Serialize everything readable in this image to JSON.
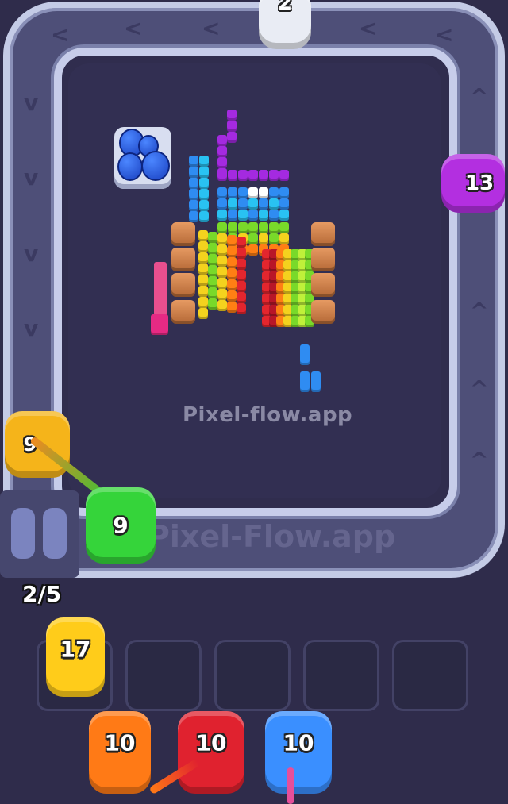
{
  "game": {
    "watermark": "Pixel-flow.app",
    "belt_watermark": "Pixel-Flow.app",
    "queue_counter": "2/5",
    "chevron_left": "<",
    "chevron_up": "^",
    "chevron_down": "v"
  },
  "belt_pigs": {
    "top": {
      "count": "2",
      "color": "#e9ecf4"
    },
    "right": {
      "count": "13",
      "color": "#b32fe0"
    },
    "left": {
      "count": "9",
      "color": "#f5b41a"
    },
    "bottom": {
      "count": "9",
      "color": "#35d43a"
    }
  },
  "held_pig": {
    "count": "17",
    "color": "#ffcc1a"
  },
  "waiting_pigs": [
    {
      "count": "10",
      "color": "#ff7a16"
    },
    {
      "count": "10",
      "color": "#e0222f"
    },
    {
      "count": "10",
      "color": "#3a8fff"
    }
  ],
  "slots": [
    "",
    "",
    "",
    "",
    ""
  ]
}
